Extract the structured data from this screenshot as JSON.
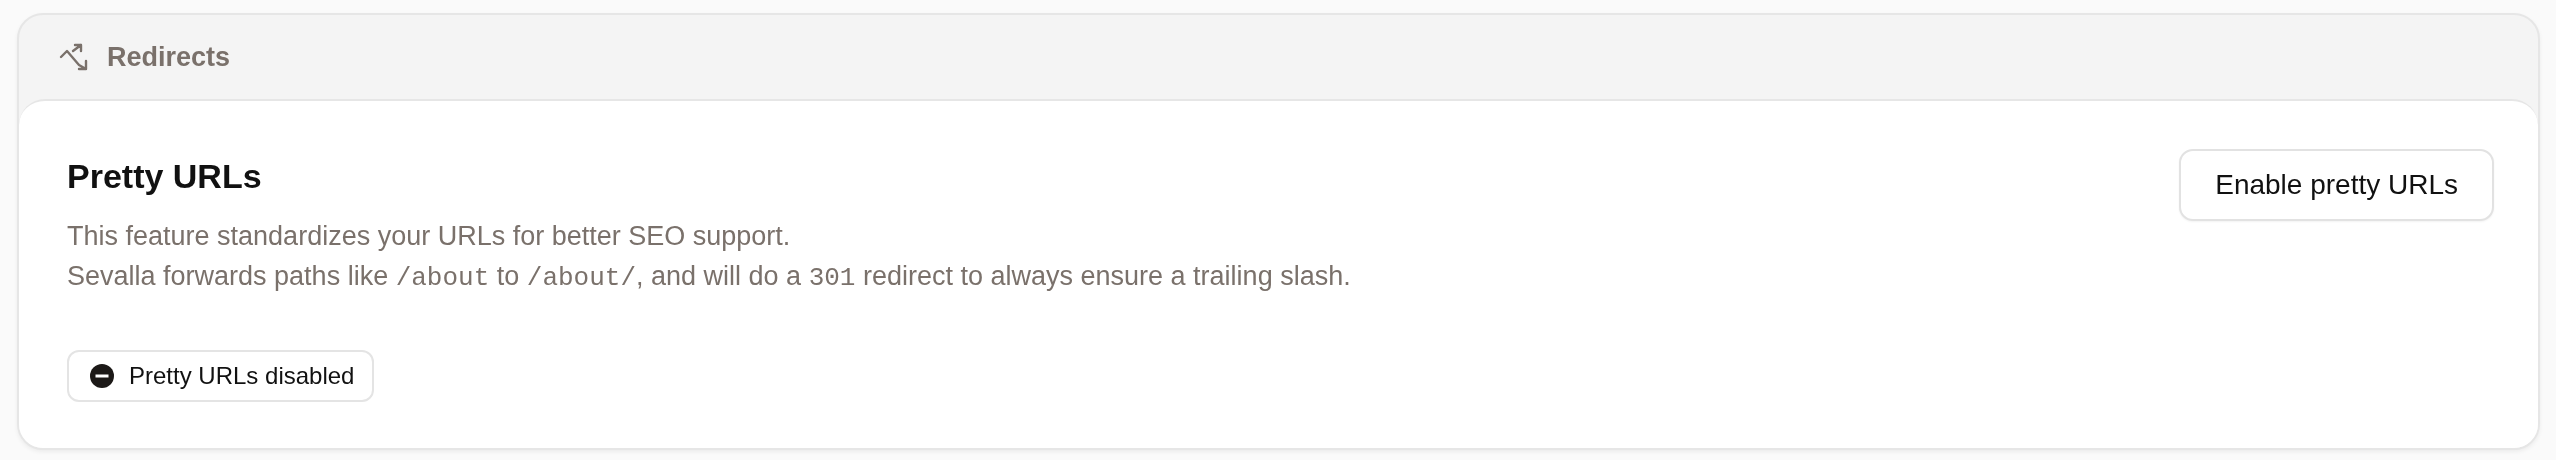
{
  "section": {
    "title": "Redirects"
  },
  "card": {
    "title": "Pretty URLs",
    "description": [
      [
        {
          "kind": "text",
          "text": "This feature standardizes your URLs for better SEO support."
        }
      ],
      [
        {
          "kind": "text",
          "text": "Sevalla forwards paths like "
        },
        {
          "kind": "code",
          "text": "/about"
        },
        {
          "kind": "text",
          "text": " to "
        },
        {
          "kind": "code",
          "text": "/about/"
        },
        {
          "kind": "text",
          "text": ", and will do a "
        },
        {
          "kind": "code",
          "text": "301"
        },
        {
          "kind": "text",
          "text": " redirect to always ensure a trailing slash."
        }
      ]
    ],
    "status": {
      "label": "Pretty URLs disabled",
      "enabled": false
    },
    "action": {
      "label": "Enable pretty URLs"
    }
  }
}
